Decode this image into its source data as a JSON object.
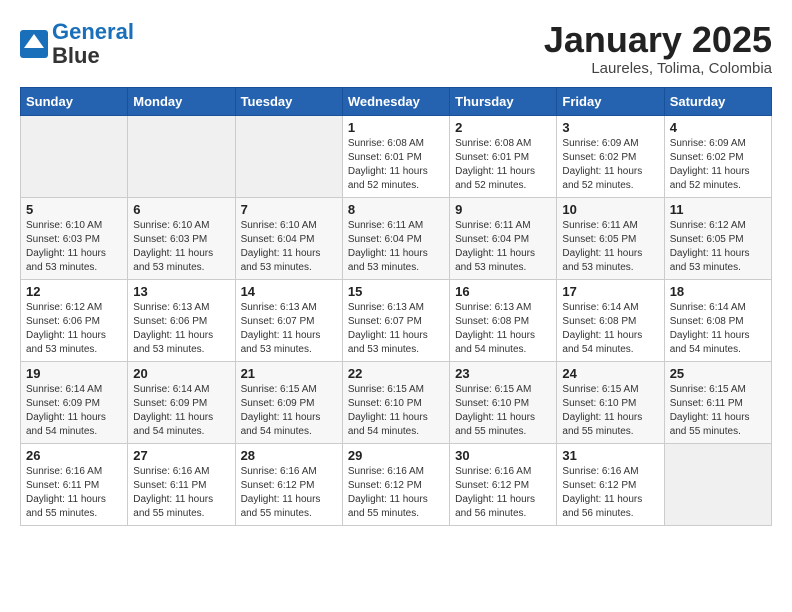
{
  "header": {
    "logo_line1": "General",
    "logo_line2": "Blue",
    "month": "January 2025",
    "location": "Laureles, Tolima, Colombia"
  },
  "weekdays": [
    "Sunday",
    "Monday",
    "Tuesday",
    "Wednesday",
    "Thursday",
    "Friday",
    "Saturday"
  ],
  "weeks": [
    [
      {
        "day": "",
        "info": ""
      },
      {
        "day": "",
        "info": ""
      },
      {
        "day": "",
        "info": ""
      },
      {
        "day": "1",
        "info": "Sunrise: 6:08 AM\nSunset: 6:01 PM\nDaylight: 11 hours and 52 minutes."
      },
      {
        "day": "2",
        "info": "Sunrise: 6:08 AM\nSunset: 6:01 PM\nDaylight: 11 hours and 52 minutes."
      },
      {
        "day": "3",
        "info": "Sunrise: 6:09 AM\nSunset: 6:02 PM\nDaylight: 11 hours and 52 minutes."
      },
      {
        "day": "4",
        "info": "Sunrise: 6:09 AM\nSunset: 6:02 PM\nDaylight: 11 hours and 52 minutes."
      }
    ],
    [
      {
        "day": "5",
        "info": "Sunrise: 6:10 AM\nSunset: 6:03 PM\nDaylight: 11 hours and 53 minutes."
      },
      {
        "day": "6",
        "info": "Sunrise: 6:10 AM\nSunset: 6:03 PM\nDaylight: 11 hours and 53 minutes."
      },
      {
        "day": "7",
        "info": "Sunrise: 6:10 AM\nSunset: 6:04 PM\nDaylight: 11 hours and 53 minutes."
      },
      {
        "day": "8",
        "info": "Sunrise: 6:11 AM\nSunset: 6:04 PM\nDaylight: 11 hours and 53 minutes."
      },
      {
        "day": "9",
        "info": "Sunrise: 6:11 AM\nSunset: 6:04 PM\nDaylight: 11 hours and 53 minutes."
      },
      {
        "day": "10",
        "info": "Sunrise: 6:11 AM\nSunset: 6:05 PM\nDaylight: 11 hours and 53 minutes."
      },
      {
        "day": "11",
        "info": "Sunrise: 6:12 AM\nSunset: 6:05 PM\nDaylight: 11 hours and 53 minutes."
      }
    ],
    [
      {
        "day": "12",
        "info": "Sunrise: 6:12 AM\nSunset: 6:06 PM\nDaylight: 11 hours and 53 minutes."
      },
      {
        "day": "13",
        "info": "Sunrise: 6:13 AM\nSunset: 6:06 PM\nDaylight: 11 hours and 53 minutes."
      },
      {
        "day": "14",
        "info": "Sunrise: 6:13 AM\nSunset: 6:07 PM\nDaylight: 11 hours and 53 minutes."
      },
      {
        "day": "15",
        "info": "Sunrise: 6:13 AM\nSunset: 6:07 PM\nDaylight: 11 hours and 53 minutes."
      },
      {
        "day": "16",
        "info": "Sunrise: 6:13 AM\nSunset: 6:08 PM\nDaylight: 11 hours and 54 minutes."
      },
      {
        "day": "17",
        "info": "Sunrise: 6:14 AM\nSunset: 6:08 PM\nDaylight: 11 hours and 54 minutes."
      },
      {
        "day": "18",
        "info": "Sunrise: 6:14 AM\nSunset: 6:08 PM\nDaylight: 11 hours and 54 minutes."
      }
    ],
    [
      {
        "day": "19",
        "info": "Sunrise: 6:14 AM\nSunset: 6:09 PM\nDaylight: 11 hours and 54 minutes."
      },
      {
        "day": "20",
        "info": "Sunrise: 6:14 AM\nSunset: 6:09 PM\nDaylight: 11 hours and 54 minutes."
      },
      {
        "day": "21",
        "info": "Sunrise: 6:15 AM\nSunset: 6:09 PM\nDaylight: 11 hours and 54 minutes."
      },
      {
        "day": "22",
        "info": "Sunrise: 6:15 AM\nSunset: 6:10 PM\nDaylight: 11 hours and 54 minutes."
      },
      {
        "day": "23",
        "info": "Sunrise: 6:15 AM\nSunset: 6:10 PM\nDaylight: 11 hours and 55 minutes."
      },
      {
        "day": "24",
        "info": "Sunrise: 6:15 AM\nSunset: 6:10 PM\nDaylight: 11 hours and 55 minutes."
      },
      {
        "day": "25",
        "info": "Sunrise: 6:15 AM\nSunset: 6:11 PM\nDaylight: 11 hours and 55 minutes."
      }
    ],
    [
      {
        "day": "26",
        "info": "Sunrise: 6:16 AM\nSunset: 6:11 PM\nDaylight: 11 hours and 55 minutes."
      },
      {
        "day": "27",
        "info": "Sunrise: 6:16 AM\nSunset: 6:11 PM\nDaylight: 11 hours and 55 minutes."
      },
      {
        "day": "28",
        "info": "Sunrise: 6:16 AM\nSunset: 6:12 PM\nDaylight: 11 hours and 55 minutes."
      },
      {
        "day": "29",
        "info": "Sunrise: 6:16 AM\nSunset: 6:12 PM\nDaylight: 11 hours and 55 minutes."
      },
      {
        "day": "30",
        "info": "Sunrise: 6:16 AM\nSunset: 6:12 PM\nDaylight: 11 hours and 56 minutes."
      },
      {
        "day": "31",
        "info": "Sunrise: 6:16 AM\nSunset: 6:12 PM\nDaylight: 11 hours and 56 minutes."
      },
      {
        "day": "",
        "info": ""
      }
    ]
  ]
}
